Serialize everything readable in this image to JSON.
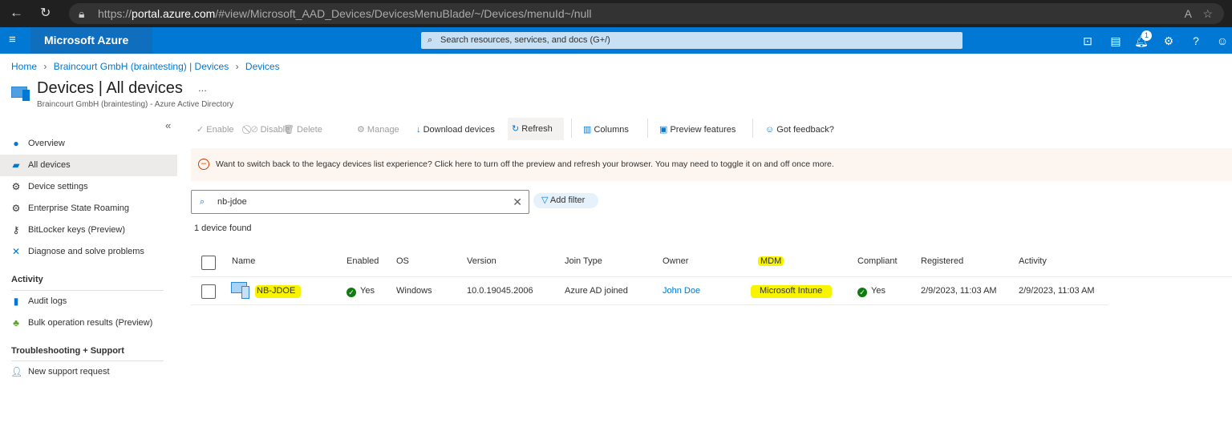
{
  "browser": {
    "url_prefix": "https://",
    "url_host": "portal.azure.com",
    "url_path": "/#view/Microsoft_AAD_Devices/DevicesMenuBlade/~/Devices/menuId~/null"
  },
  "topbar": {
    "brand": "Microsoft Azure",
    "search_placeholder": "Search resources, services, and docs (G+/)",
    "notification_count": "1"
  },
  "breadcrumb": [
    "Home",
    "Braincourt GmbH (braintesting) | Devices",
    "Devices"
  ],
  "header": {
    "title": "Devices | All devices",
    "more": "...",
    "subtitle": "Braincourt GmbH (braintesting) - Azure Active Directory"
  },
  "sidebar": {
    "items": [
      {
        "label": "Overview",
        "icon": "info-icon"
      },
      {
        "label": "All devices",
        "icon": "devices-icon"
      },
      {
        "label": "Device settings",
        "icon": "gear-icon"
      },
      {
        "label": "Enterprise State Roaming",
        "icon": "gear-icon"
      },
      {
        "label": "BitLocker keys (Preview)",
        "icon": "key-icon"
      },
      {
        "label": "Diagnose and solve problems",
        "icon": "wrench-icon"
      }
    ],
    "activity_heading": "Activity",
    "activity": [
      {
        "label": "Audit logs",
        "icon": "log-icon"
      },
      {
        "label": "Bulk operation results (Preview)",
        "icon": "bulk-icon"
      }
    ],
    "support_heading": "Troubleshooting + Support",
    "support": [
      {
        "label": "New support request",
        "icon": "support-icon"
      }
    ],
    "collapse": "«"
  },
  "toolbar": {
    "enable": "Enable",
    "disable": "Disable",
    "delete": "Delete",
    "manage": "Manage",
    "download": "Download devices",
    "refresh": "Refresh",
    "columns": "Columns",
    "preview": "Preview features",
    "feedback": "Got feedback?"
  },
  "banner": "Want to switch back to the legacy devices list experience? Click here to turn off the preview and refresh your browser. You may need to toggle it on and off once more.",
  "filter": {
    "search_value": "nb-jdoe",
    "add_filter": "Add filter",
    "result_count": "1 device found"
  },
  "table": {
    "columns": [
      "Name",
      "Enabled",
      "OS",
      "Version",
      "Join Type",
      "Owner",
      "MDM",
      "Compliant",
      "Registered",
      "Activity"
    ],
    "rows": [
      {
        "name": "NB-JDOE",
        "enabled": "Yes",
        "os": "Windows",
        "version": "10.0.19045.2006",
        "join_type": "Azure AD joined",
        "owner": "John Doe",
        "mdm": "Microsoft Intune",
        "compliant": "Yes",
        "registered": "2/9/2023, 11:03 AM",
        "activity": "2/9/2023, 11:03 AM"
      }
    ]
  },
  "colors": {
    "accent": "#0078d4",
    "highlight": "#f8f400",
    "success": "#107c10",
    "banner": "#fdf6f0"
  }
}
